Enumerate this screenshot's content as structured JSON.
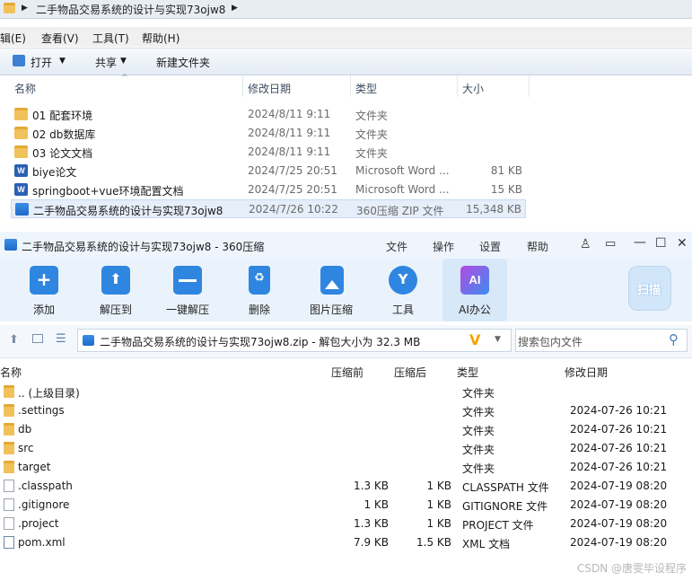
{
  "explorer": {
    "breadcrumb": "二手物品交易系统的设计与实现73ojw8",
    "menu": [
      "辑(E)",
      "查看(V)",
      "工具(T)",
      "帮助(H)"
    ],
    "commands": {
      "open": "打开",
      "share": "共享",
      "new_folder": "新建文件夹"
    },
    "columns": {
      "name": "名称",
      "date": "修改日期",
      "type": "类型",
      "size": "大小"
    },
    "files": [
      {
        "name": "01 配套环境",
        "date": "2024/8/11 9:11",
        "type": "文件夹",
        "size": "",
        "icon": "folder-icon"
      },
      {
        "name": "02 db数据库",
        "date": "2024/8/11 9:11",
        "type": "文件夹",
        "size": "",
        "icon": "folder-icon"
      },
      {
        "name": "03 论文文档",
        "date": "2024/8/11 9:11",
        "type": "文件夹",
        "size": "",
        "icon": "folder-icon"
      },
      {
        "name": "biye论文",
        "date": "2024/7/25 20:51",
        "type": "Microsoft Word ...",
        "size": "81 KB",
        "icon": "word-icon"
      },
      {
        "name": "springboot+vue环境配置文档",
        "date": "2024/7/25 20:51",
        "type": "Microsoft Word ...",
        "size": "15 KB",
        "icon": "word-icon"
      },
      {
        "name": "二手物品交易系统的设计与实现73ojw8",
        "date": "2024/7/26 10:22",
        "type": "360压缩 ZIP 文件",
        "size": "15,348 KB",
        "icon": "zip-icon"
      }
    ]
  },
  "zip": {
    "title": "二手物品交易系统的设计与实现73ojw8 - 360压缩",
    "title_menu": [
      "文件",
      "操作",
      "设置",
      "帮助"
    ],
    "tools": [
      {
        "label": "添加",
        "icon": "add-icon",
        "color": "#2f86e0"
      },
      {
        "label": "解压到",
        "icon": "extract-to-icon",
        "color": "#2f86e0"
      },
      {
        "label": "一键解压",
        "icon": "one-click-extract-icon",
        "color": "#2f86e0"
      },
      {
        "label": "删除",
        "icon": "delete-icon",
        "color": "#2f86e0"
      },
      {
        "label": "图片压缩",
        "icon": "image-compress-icon",
        "color": "#2f86e0"
      },
      {
        "label": "工具",
        "icon": "tools-icon",
        "color": "#2f86e0"
      },
      {
        "label": "AI办公",
        "icon": "ai-office-icon",
        "color": "#2f86e0"
      }
    ],
    "scan_label": "扫描",
    "path_text": "二手物品交易系统的设计与实现73ojw8.zip - 解包大小为 32.3 MB",
    "search_placeholder": "搜索包内文件",
    "columns": {
      "name": "名称",
      "before": "压缩前",
      "after": "压缩后",
      "type": "类型",
      "date": "修改日期"
    },
    "entries": [
      {
        "name": ".. (上级目录)",
        "before": "",
        "after": "",
        "type": "文件夹",
        "date": "",
        "kind": "folder"
      },
      {
        "name": ".settings",
        "before": "",
        "after": "",
        "type": "文件夹",
        "date": "2024-07-26 10:21",
        "kind": "folder"
      },
      {
        "name": "db",
        "before": "",
        "after": "",
        "type": "文件夹",
        "date": "2024-07-26 10:21",
        "kind": "folder"
      },
      {
        "name": "src",
        "before": "",
        "after": "",
        "type": "文件夹",
        "date": "2024-07-26 10:21",
        "kind": "folder"
      },
      {
        "name": "target",
        "before": "",
        "after": "",
        "type": "文件夹",
        "date": "2024-07-26 10:21",
        "kind": "folder"
      },
      {
        "name": ".classpath",
        "before": "1.3 KB",
        "after": "1 KB",
        "type": "CLASSPATH 文件",
        "date": "2024-07-19 08:20",
        "kind": "file"
      },
      {
        "name": ".gitignore",
        "before": "1 KB",
        "after": "1 KB",
        "type": "GITIGNORE 文件",
        "date": "2024-07-19 08:20",
        "kind": "file"
      },
      {
        "name": ".project",
        "before": "1.3 KB",
        "after": "1 KB",
        "type": "PROJECT 文件",
        "date": "2024-07-19 08:20",
        "kind": "file"
      },
      {
        "name": "pom.xml",
        "before": "7.9 KB",
        "after": "1.5 KB",
        "type": "XML 文档",
        "date": "2024-07-19 08:20",
        "kind": "file"
      }
    ]
  },
  "watermark": "CSDN @唐雯毕设程序"
}
